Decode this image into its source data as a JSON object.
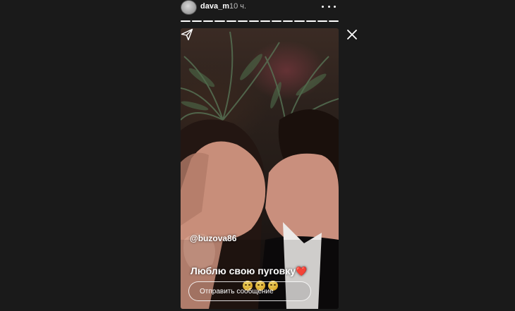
{
  "header": {
    "username": "dava_m",
    "timestamp": "10 ч.",
    "more_icon": "more-horizontal-icon",
    "avatar_icon": "avatar"
  },
  "progress": {
    "segments_total": 14,
    "segments_viewed": 14
  },
  "close_icon": "close-icon",
  "story": {
    "mention": "@buzova86",
    "caption": "Люблю свою пуговку",
    "caption_emoji": "❤️",
    "reaction_emojis": [
      "😚",
      "😚",
      "😚"
    ]
  },
  "reply": {
    "placeholder": "Отправить сообщение",
    "send_icon": "send-icon"
  },
  "colors": {
    "page_background": "#1a1a1a",
    "text": "#ffffff",
    "muted_text": "#bdbdbd",
    "heart": "#e0213a"
  }
}
